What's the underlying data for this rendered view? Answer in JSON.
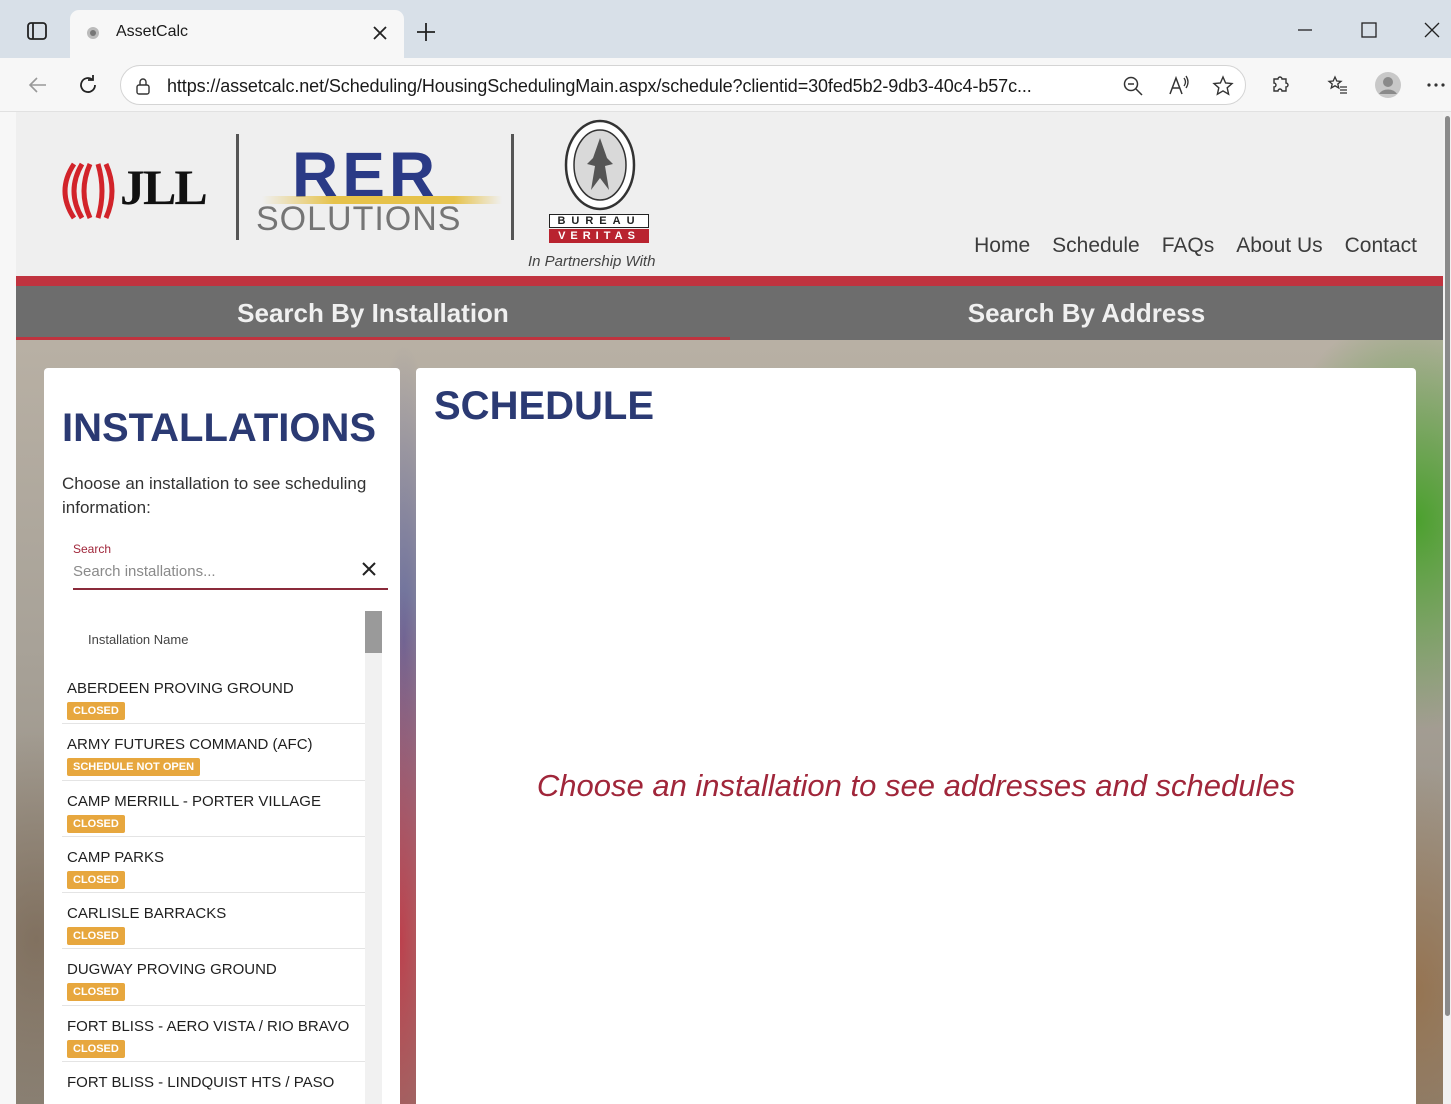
{
  "browser": {
    "tab_title": "AssetCalc",
    "url_host": "https://assetcalc.net",
    "url_path": "/Scheduling/HousingSchedulingMain.aspx/schedule?clientid=30fed5b2-9db3-40c4-b57c..."
  },
  "header": {
    "jll_logo_text": "JLL",
    "rer_title": "RER",
    "rer_subtitle": "SOLUTIONS",
    "bv_bureau": "BUREAU",
    "bv_veritas": "VERITAS",
    "partnership": "In Partnership With",
    "nav": [
      "Home",
      "Schedule",
      "FAQs",
      "About Us",
      "Contact"
    ]
  },
  "search_tabs": {
    "installation": "Search By Installation",
    "address": "Search By Address"
  },
  "installations": {
    "title": "INSTALLATIONS",
    "description": "Choose an installation to see scheduling information:",
    "search_label": "Search",
    "search_placeholder": "Search installations...",
    "column_header": "Installation Name",
    "items": [
      {
        "name": "ABERDEEN PROVING GROUND",
        "status": "CLOSED"
      },
      {
        "name": "ARMY FUTURES COMMAND (AFC)",
        "status": "SCHEDULE NOT OPEN"
      },
      {
        "name": "CAMP MERRILL - PORTER VILLAGE",
        "status": "CLOSED"
      },
      {
        "name": "CAMP PARKS",
        "status": "CLOSED"
      },
      {
        "name": "CARLISLE BARRACKS",
        "status": "CLOSED"
      },
      {
        "name": "DUGWAY PROVING GROUND",
        "status": "CLOSED"
      },
      {
        "name": "FORT BLISS - AERO VISTA / RIO BRAVO",
        "status": "CLOSED"
      },
      {
        "name": "FORT BLISS - LINDQUIST HTS / PASO",
        "status": ""
      }
    ]
  },
  "schedule": {
    "title": "SCHEDULE",
    "message": "Choose an installation to see addresses and schedules"
  },
  "colors": {
    "accent_red": "#c0333f",
    "title_blue": "#2b3a73",
    "badge_orange": "#e7a73e"
  }
}
